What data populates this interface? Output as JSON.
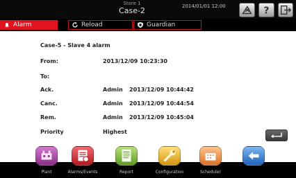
{
  "header": {
    "store": "Store 1",
    "case": "Case-2",
    "datetime": "2014/01/01  12:00"
  },
  "tabs": {
    "alarm": "Alarm",
    "reload": "Reload",
    "guardian": "Guardian"
  },
  "detail": {
    "title": "Case-5 - Slave 4 alarm",
    "from_label": "From:",
    "from_value": "2013/12/09 10:23:30",
    "to_label": "To:",
    "ack_label": "Ack.",
    "ack_user": "Admin",
    "ack_time": "2013/12/09 10:44:42",
    "canc_label": "Canc.",
    "canc_user": "Admin",
    "canc_time": "2013/12/09 10:44:54",
    "rem_label": "Rem.",
    "rem_user": "Admin",
    "rem_time": "2013/12/09 10:45:04",
    "priority_label": "Priority",
    "priority_value": "Highest"
  },
  "dock": {
    "plant": "Plant",
    "alarms": "Alarms/Events",
    "report": "Report",
    "configuration": "Configuration",
    "scheduler": "Scheduler"
  },
  "colors": {
    "alarm_red": "#e0141f",
    "plant": "#a0449c",
    "alarms": "#d0232a",
    "report": "#7cbc3a",
    "configuration": "#e8b21f",
    "scheduler": "#e8893a",
    "back": "#2f7fd6"
  }
}
